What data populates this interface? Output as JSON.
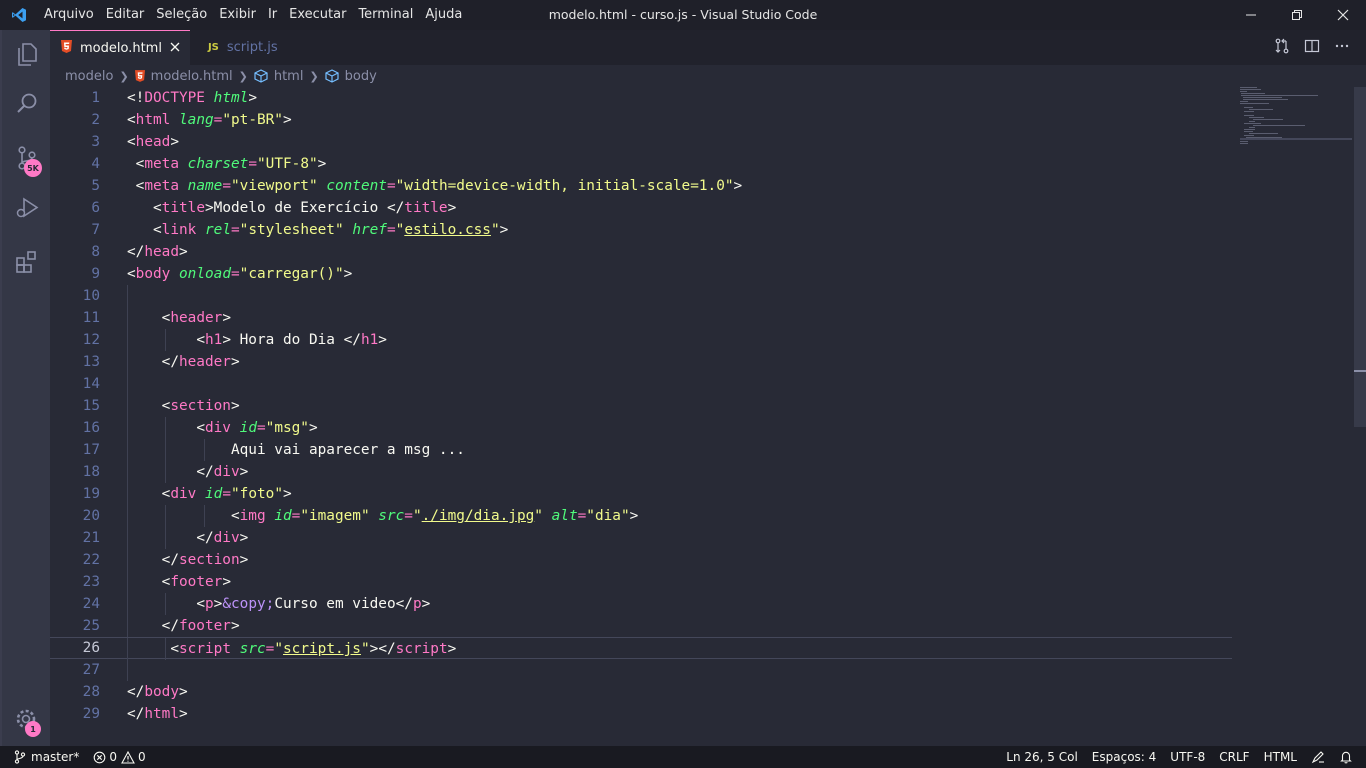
{
  "window": {
    "title": "modelo.html - curso.js - Visual Studio Code",
    "menu": [
      "Arquivo",
      "Editar",
      "Seleção",
      "Exibir",
      "Ir",
      "Executar",
      "Terminal",
      "Ajuda"
    ]
  },
  "activity_bar": {
    "items": [
      {
        "name": "explorer",
        "icon": "files-icon"
      },
      {
        "name": "search",
        "icon": "search-icon"
      },
      {
        "name": "source-control",
        "icon": "source-control-icon",
        "badge": "5K"
      },
      {
        "name": "run-debug",
        "icon": "run-debug-icon"
      },
      {
        "name": "extensions",
        "icon": "extensions-icon"
      }
    ],
    "manage": {
      "icon": "gear-icon",
      "badge": "1"
    }
  },
  "tabs": [
    {
      "label": "modelo.html",
      "icon_text": "5",
      "icon_color": "#e44d26",
      "active": true
    },
    {
      "label": "script.js",
      "icon_text": "JS",
      "icon_color": "#cbcb41",
      "active": false
    }
  ],
  "breadcrumb": [
    "modelo",
    "modelo.html",
    "html",
    "body"
  ],
  "editor": {
    "line_numbers": [
      "1",
      "2",
      "3",
      "4",
      "5",
      "6",
      "7",
      "8",
      "9",
      "10",
      "11",
      "12",
      "13",
      "14",
      "15",
      "16",
      "17",
      "18",
      "19",
      "20",
      "21",
      "22",
      "23",
      "24",
      "25",
      "26",
      "27",
      "28",
      "29"
    ],
    "current_line": 26
  },
  "status_bar": {
    "branch": "master*",
    "errors": "0",
    "warnings": "0",
    "position": "Ln 26, 5 Col",
    "spaces": "Espaços: 4",
    "encoding": "UTF-8",
    "eol": "CRLF",
    "language": "HTML"
  },
  "theme": {
    "accent": "#ff79c6",
    "background": "#282a36",
    "string": "#f1fa8c",
    "attribute": "#50fa7b"
  }
}
